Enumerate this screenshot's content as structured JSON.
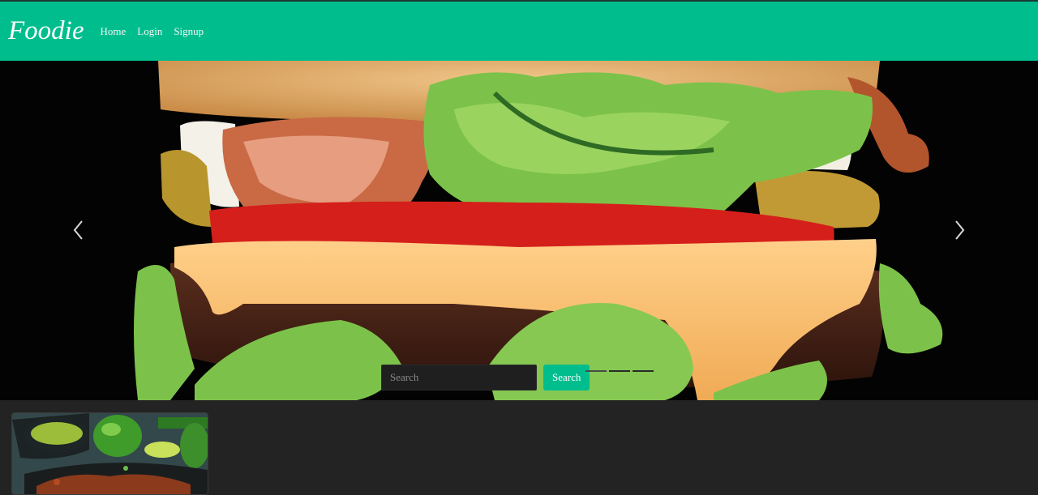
{
  "navbar": {
    "brand": "Foodie",
    "links": [
      "Home",
      "Login",
      "Signup"
    ]
  },
  "carousel": {
    "slide_image": "burger-photo",
    "prev_icon": "chevron-left-icon",
    "next_icon": "chevron-right-icon",
    "slide_count": 3,
    "active_slide": 1
  },
  "search": {
    "placeholder": "Search",
    "button_label": "Search"
  },
  "cards": [
    {
      "image": "dish-photo-peppers-curry"
    }
  ],
  "colors": {
    "accent": "#00bd8e",
    "background": "#232323",
    "nav_text": "#ffffff"
  }
}
